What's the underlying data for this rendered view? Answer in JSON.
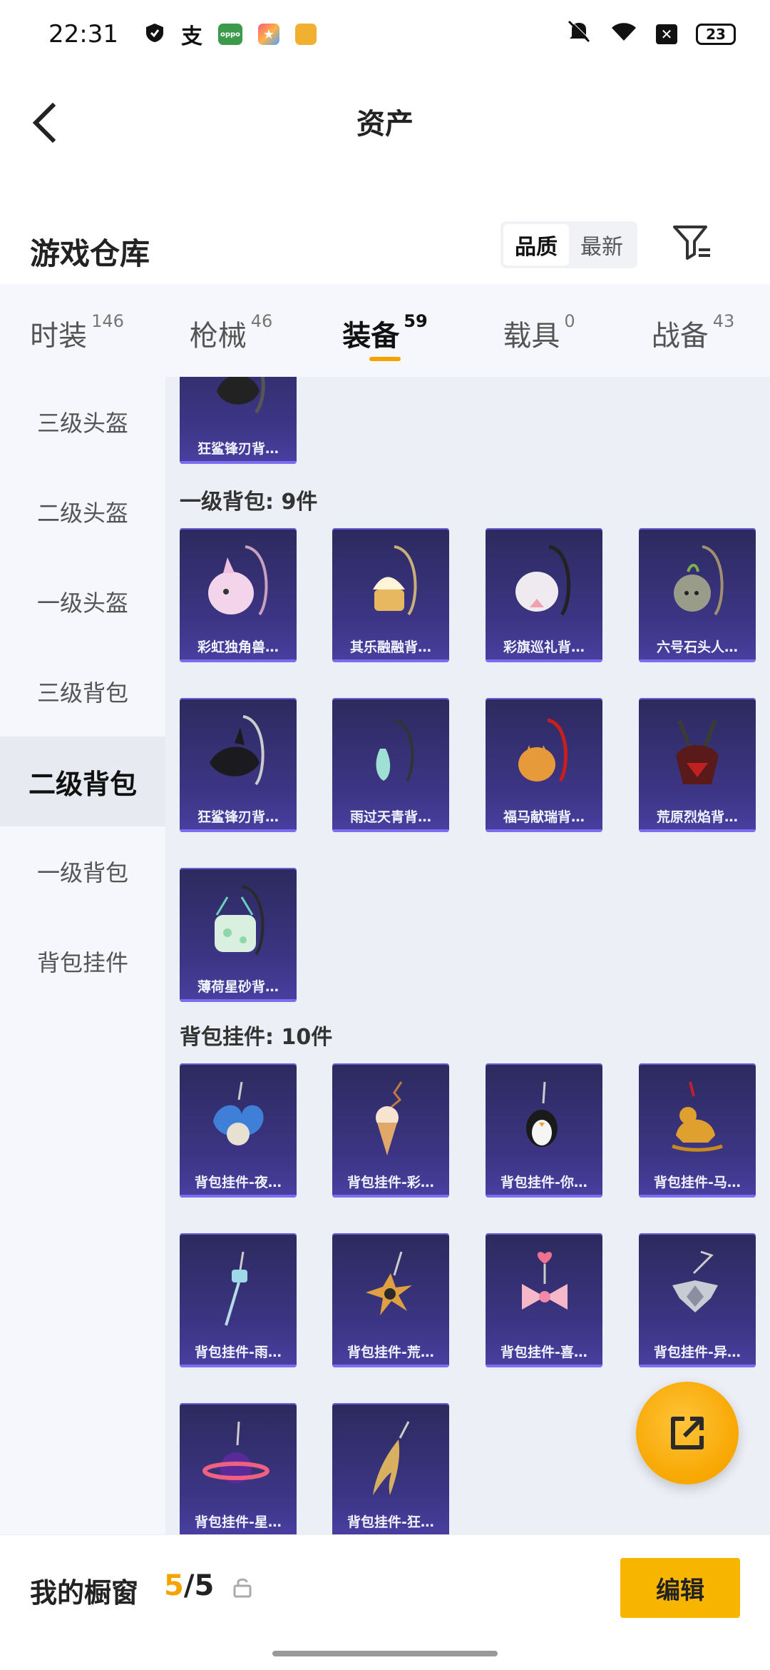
{
  "status_bar": {
    "time": "22:31",
    "battery": "23",
    "icons": [
      "shield-icon",
      "alipay-icon",
      "oppo-app-icon",
      "star-app-icon",
      "game-app-icon",
      "mute-icon",
      "wifi-icon",
      "close-box-icon",
      "battery-icon"
    ],
    "app_icon_labels": [
      "支",
      "oppo"
    ]
  },
  "nav": {
    "title": "资产",
    "back_icon": "chevron-left-icon"
  },
  "warehouse": {
    "title": "游戏仓库",
    "sort_options": [
      "品质",
      "最新"
    ],
    "sort_active": "品质",
    "filter_icon": "filter-icon"
  },
  "tabs": [
    {
      "label": "时装",
      "count": "146"
    },
    {
      "label": "枪械",
      "count": "46"
    },
    {
      "label": "装备",
      "count": "59",
      "active": true
    },
    {
      "label": "载具",
      "count": "0"
    },
    {
      "label": "战备",
      "count": "43"
    }
  ],
  "sidebar": [
    {
      "label": "三级头盔"
    },
    {
      "label": "二级头盔"
    },
    {
      "label": "一级头盔"
    },
    {
      "label": "三级背包"
    },
    {
      "label": "二级背包",
      "active": true
    },
    {
      "label": "一级背包"
    },
    {
      "label": "背包挂件"
    }
  ],
  "sections": {
    "partial_item": "狂鲨锋刃背…",
    "backpack_l1_title": "一级背包: 9件",
    "backpack_l1_items": [
      "彩虹独角兽…",
      "其乐融融背…",
      "彩旗巡礼背…",
      "六号石头人…",
      "狂鲨锋刃背…",
      "雨过天青背…",
      "福马献瑞背…",
      "荒原烈焰背…",
      "薄荷星砂背…"
    ],
    "charm_title": "背包挂件: 10件",
    "charm_items": [
      "背包挂件-夜…",
      "背包挂件-彩…",
      "背包挂件-你…",
      "背包挂件-马…",
      "背包挂件-雨…",
      "背包挂件-荒…",
      "背包挂件-喜…",
      "背包挂件-异…",
      "背包挂件-星…",
      "背包挂件-狂…"
    ]
  },
  "fab": {
    "icon": "share-external-icon"
  },
  "bottom": {
    "label": "我的橱窗",
    "current": "5",
    "separator": "/",
    "total": "5",
    "lock_icon": "unlock-icon",
    "edit_label": "编辑"
  }
}
